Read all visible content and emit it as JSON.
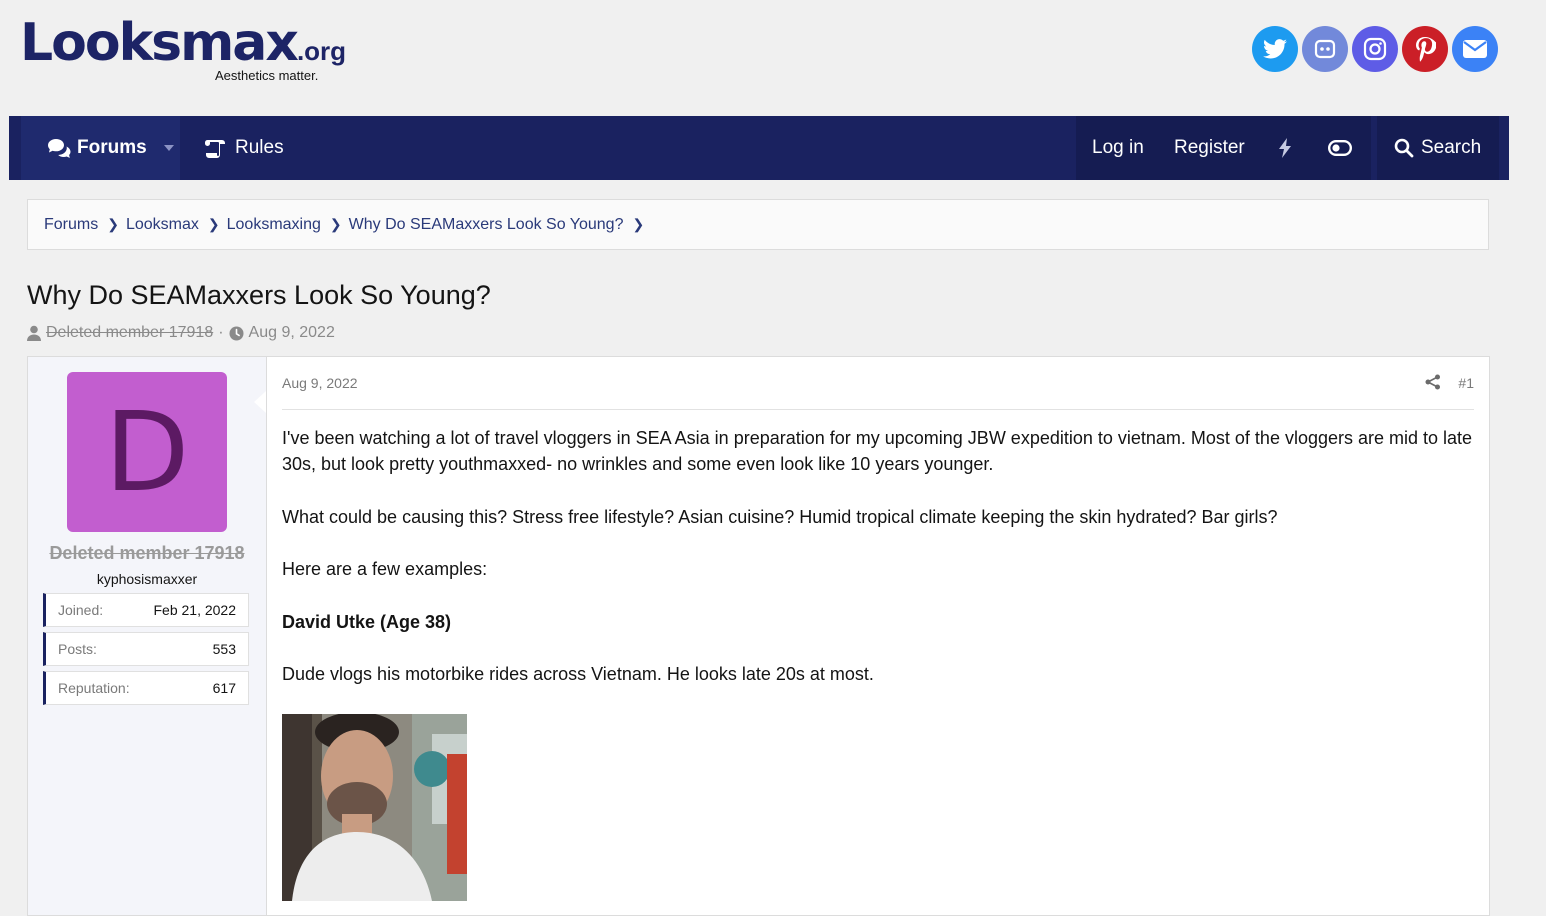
{
  "header": {
    "logo_text": "Looksmax",
    "logo_suffix": ".org",
    "tagline": "Aesthetics matter.",
    "socials": [
      {
        "name": "twitter-icon",
        "color": "#1d9bf0"
      },
      {
        "name": "discord-icon",
        "color": "#5865f2"
      },
      {
        "name": "instagram-icon",
        "color": "#5e5ce6"
      },
      {
        "name": "pinterest-icon",
        "color": "#cb1f27"
      },
      {
        "name": "email-icon",
        "color": "#3b82f6"
      }
    ]
  },
  "nav": {
    "forums": "Forums",
    "rules": "Rules",
    "login": "Log in",
    "register": "Register",
    "search": "Search"
  },
  "breadcrumb": [
    "Forums",
    "Looksmax",
    "Looksmaxing",
    "Why Do SEAMaxxers Look So Young?"
  ],
  "thread": {
    "title": "Why Do SEAMaxxers Look So Young?",
    "author": "Deleted member 17918",
    "date": "Aug 9, 2022"
  },
  "post": {
    "user": {
      "avatar_letter": "D",
      "name": "Deleted member 17918",
      "title": "kyphosismaxxer",
      "stats": [
        {
          "label": "Joined:",
          "value": "Feb 21, 2022"
        },
        {
          "label": "Posts:",
          "value": "553"
        },
        {
          "label": "Reputation:",
          "value": "617"
        }
      ]
    },
    "date": "Aug 9, 2022",
    "number": "#1",
    "paragraphs": [
      "I've been watching a lot of travel vloggers in SEA Asia in preparation for my upcoming JBW expedition to vietnam. Most of the vloggers are mid to late 30s, but look pretty youthmaxxed- no wrinkles and some even look like 10 years younger.",
      "What could be causing this? Stress free lifestyle? Asian cuisine? Humid tropical climate keeping the skin hydrated? Bar girls?",
      "Here are a few examples:",
      "David Utke (Age 38)",
      "Dude vlogs his motorbike rides across Vietnam. He looks late 20s at most."
    ]
  }
}
